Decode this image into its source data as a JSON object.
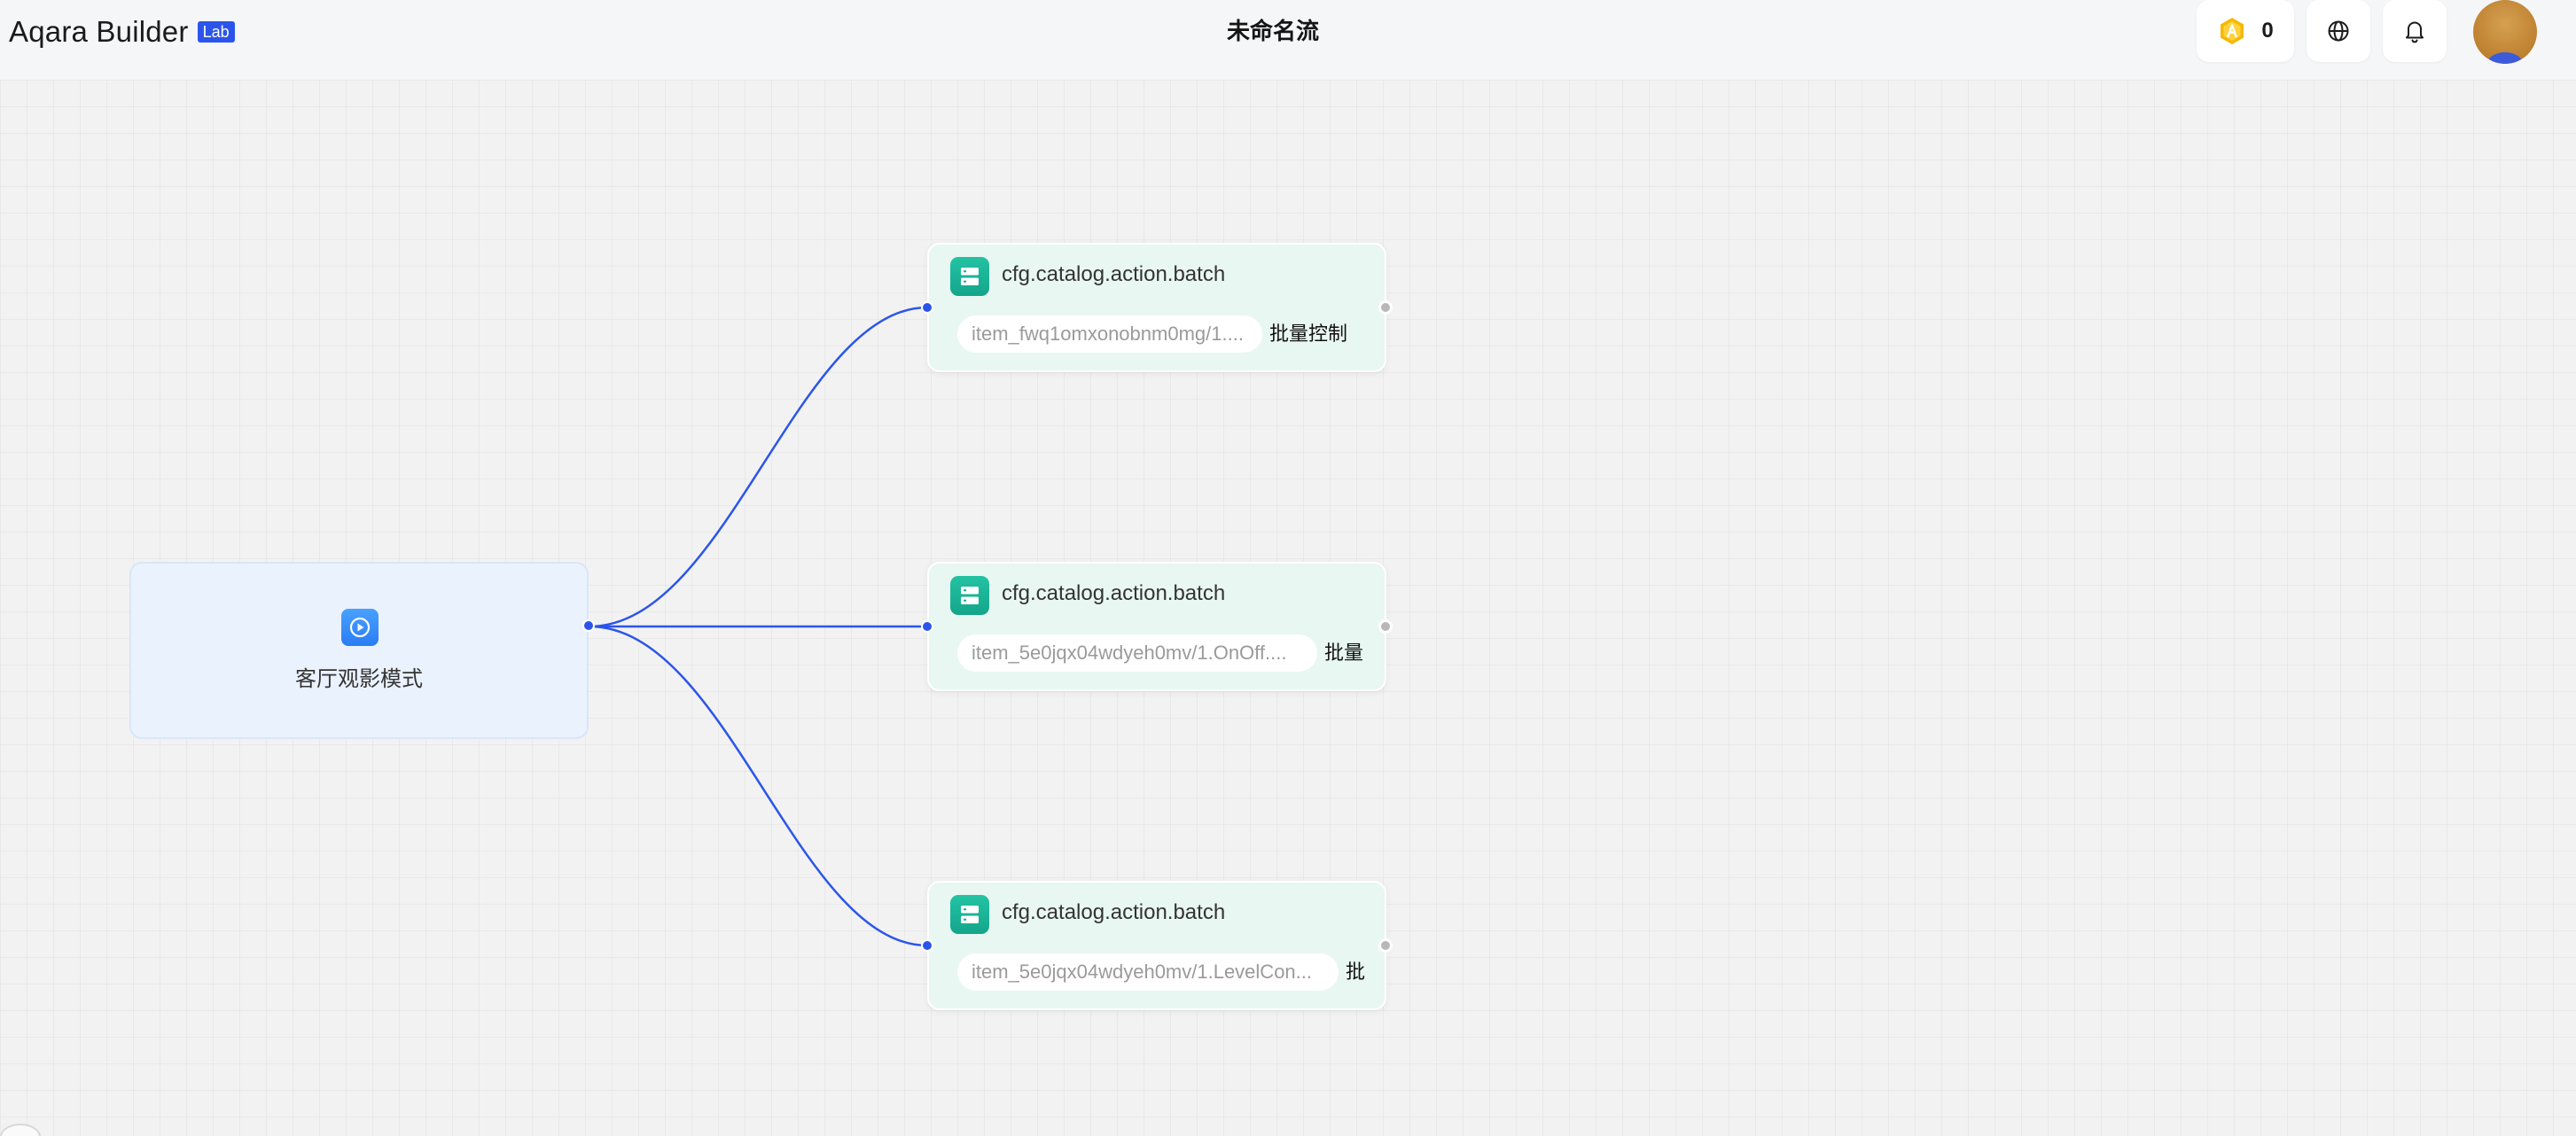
{
  "header": {
    "brand_name": "Aqara Builder",
    "brand_tag": "Lab",
    "title": "未命名流",
    "credits": "0"
  },
  "trigger": {
    "label": "客厅观影模式",
    "icon": "play-icon"
  },
  "actions": [
    {
      "title": "cfg.catalog.action.batch",
      "item": "item_fwq1omxonobnm0mg/1....",
      "tag": "批量控制"
    },
    {
      "title": "cfg.catalog.action.batch",
      "item": "item_5e0jqx04wdyeh0mv/1.OnOff....",
      "tag": "批量"
    },
    {
      "title": "cfg.catalog.action.batch",
      "item": "item_5e0jqx04wdyeh0mv/1.LevelCon...",
      "tag": "批"
    }
  ],
  "colors": {
    "accent": "#2b55ea",
    "trigger_bg": "#eaf2fe",
    "action_bg": "#e8f7f1",
    "action_icon": "#1bb596"
  }
}
